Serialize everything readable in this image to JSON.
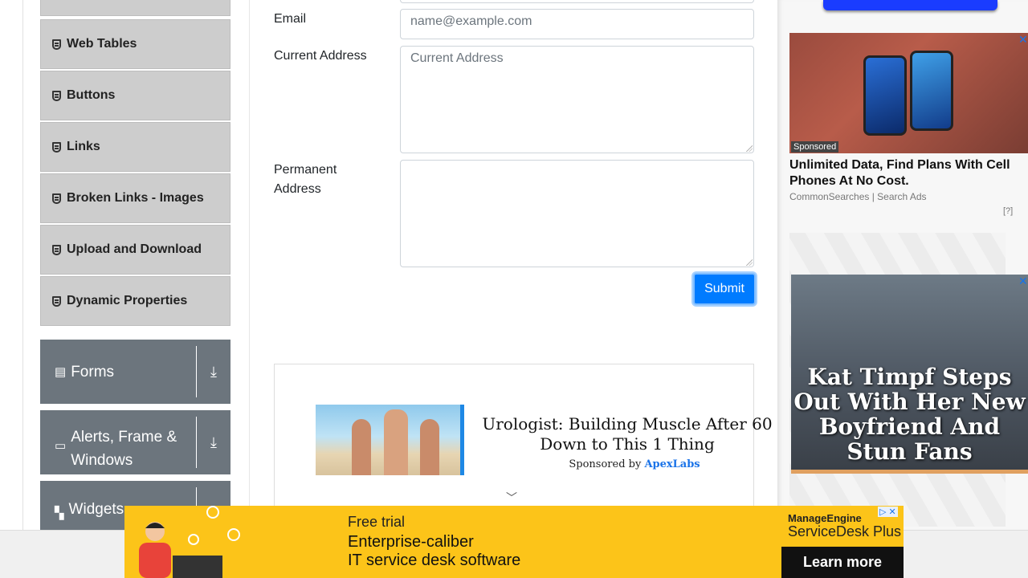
{
  "sidebar": {
    "items": [
      {
        "label": "Web Tables"
      },
      {
        "label": "Buttons"
      },
      {
        "label": "Links"
      },
      {
        "label": "Broken Links - Images"
      },
      {
        "label": "Upload and Download"
      },
      {
        "label": "Dynamic Properties"
      }
    ],
    "groups": [
      {
        "label": "Forms"
      },
      {
        "label": "Alerts, Frame & Windows"
      },
      {
        "label": "Widgets"
      }
    ]
  },
  "form": {
    "email_label": "Email",
    "email_placeholder": "name@example.com",
    "current_address_label": "Current Address",
    "current_address_placeholder": "Current Address",
    "permanent_address_label": "Permanent Address",
    "submit_label": "Submit"
  },
  "inline_ad": {
    "title": "Urologist: Building Muscle After 60 Down to This 1 Thing",
    "sponsored_prefix": "Sponsored by",
    "sponsor": "ApexLabs"
  },
  "right_ads": {
    "ad1": {
      "badge": "Sponsored",
      "title": "Unlimited Data, Find Plans With Cell Phones At No Cost.",
      "source": "CommonSearches | Search Ads",
      "help": "[?]"
    },
    "ad2": {
      "headline": "Kat Timpf Steps Out With Her New Boyfriend And Stun Fans"
    }
  },
  "banner": {
    "free_trial": "Free trial",
    "headline_line1": "Enterprise-caliber",
    "headline_line2": "IT service desk software",
    "brand_top": "ManageEngine",
    "brand_bottom": "ServiceDesk Plus",
    "cta": "Learn more"
  },
  "colors": {
    "primary": "#007bff",
    "sidebar_group": "#6c757d",
    "sidebar_item": "#cdcdcd",
    "banner": "#fcc419"
  }
}
